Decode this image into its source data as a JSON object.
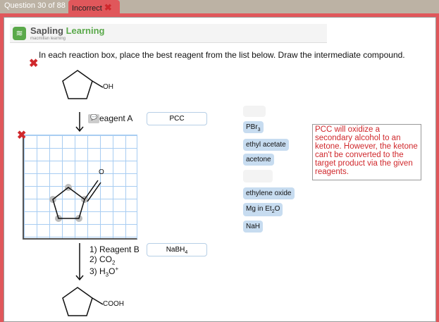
{
  "tabs": {
    "question": "Question 30 of 88",
    "status": "Incorrect"
  },
  "brand": {
    "name1": "Sapling",
    "name2": "Learning",
    "sub": "macmillan learning"
  },
  "instructions": "In each reaction box, place the best reagent from the list below. Draw the intermediate compound.",
  "start_molecule": {
    "label": "OH"
  },
  "step1": {
    "label": "eagent A",
    "answer": "PCC"
  },
  "drawn_molecule": {
    "atom": "O"
  },
  "step2": {
    "label1": "1) Reagent B",
    "label2": "2) CO",
    "sub2": "2",
    "label3": "3) H",
    "sub3": "3",
    "tail3": "O",
    "sup3": "+",
    "answer": "NaBH",
    "answer_sub": "4"
  },
  "product": {
    "label": "COOH"
  },
  "reagents": [
    {
      "text": "PBr",
      "sub": "3"
    },
    {
      "text": "ethyl acetate"
    },
    {
      "text": "acetone"
    },
    {
      "text": "ethylene oxide"
    },
    {
      "text": "Mg in Et",
      "sub": "2",
      "tail": "O"
    },
    {
      "text": "NaH"
    }
  ],
  "feedback": "PCC will oxidize a secondary alcohol to an ketone. However, the ketone can't be converted to the target product via the given reagents.",
  "colors": {
    "frame": "#e0575b",
    "brand": "#5aa94a",
    "error": "#d0282c",
    "chip": "#c7dcf0"
  }
}
